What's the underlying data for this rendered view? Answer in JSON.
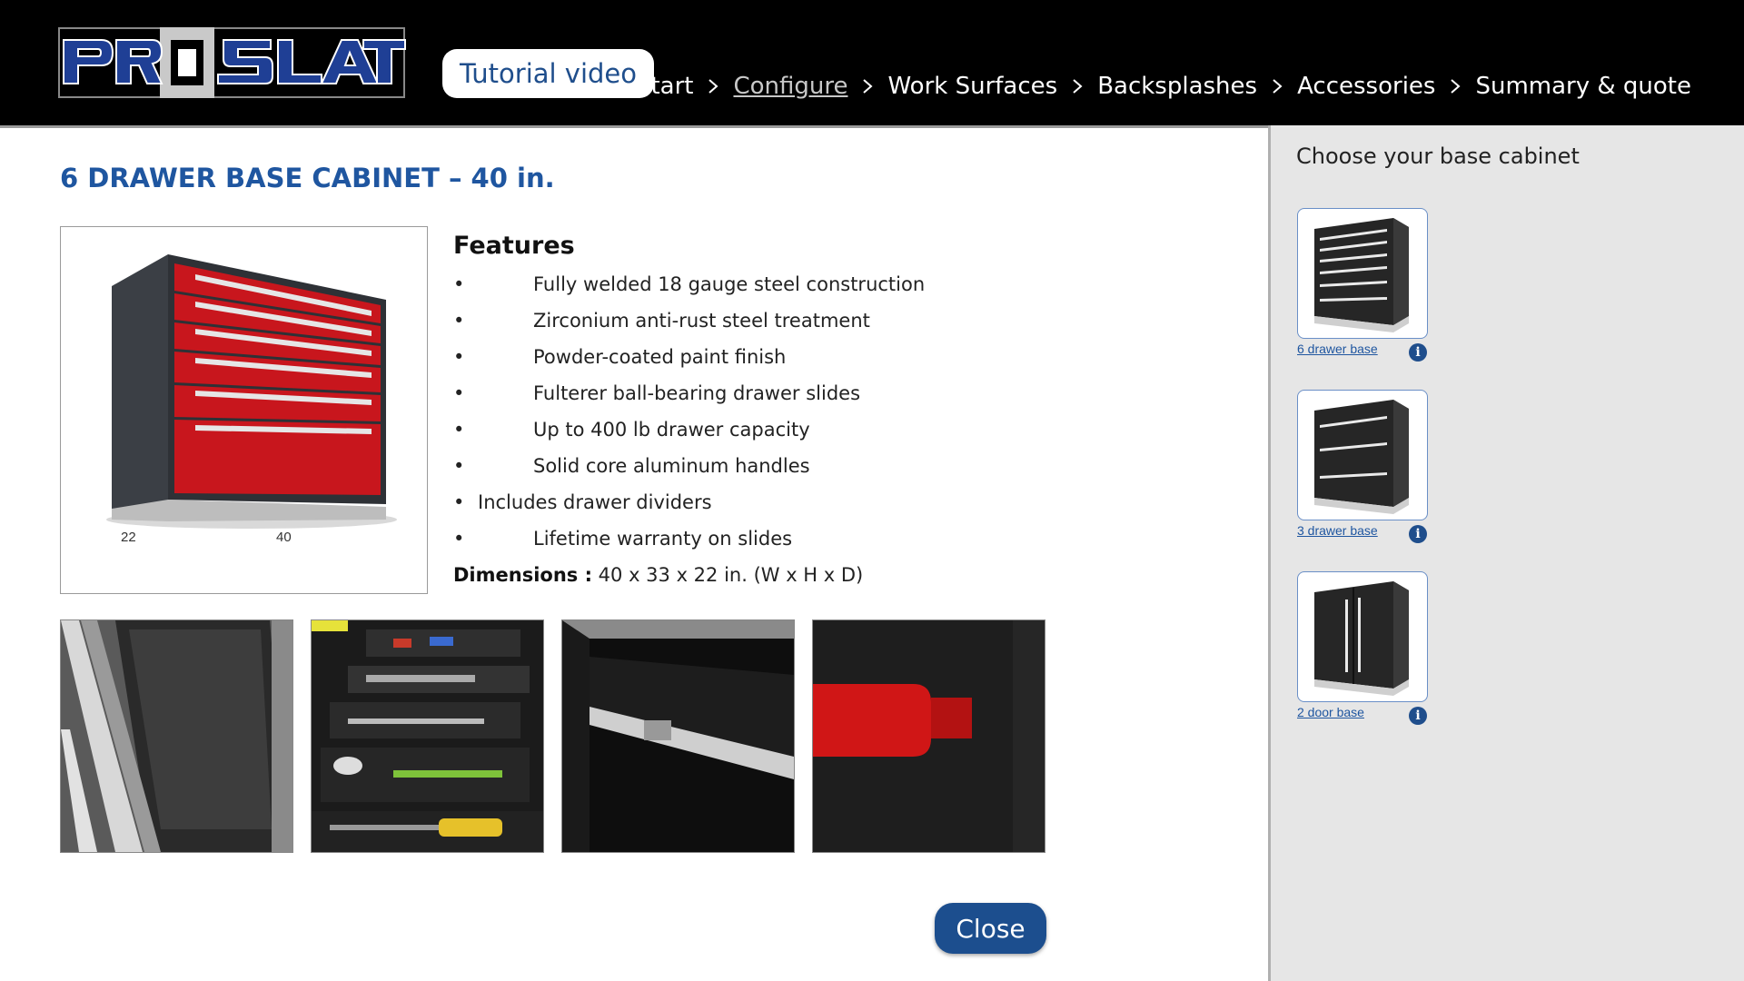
{
  "header": {
    "logo_text": "PROSLAT",
    "tutorial_label": "Tutorial video",
    "breadcrumb": [
      {
        "label": "Start"
      },
      {
        "label": "Configure",
        "current": true
      },
      {
        "label": "Work Surfaces"
      },
      {
        "label": "Backsplashes"
      },
      {
        "label": "Accessories"
      },
      {
        "label": "Summary & quote"
      }
    ]
  },
  "product": {
    "title": "6 DRAWER BASE CABINET – 40 in.",
    "image_dims": {
      "depth": "22",
      "width": "40"
    },
    "features_heading": "Features",
    "features": [
      "Fully welded 18 gauge steel construction",
      "Zirconium anti-rust steel treatment",
      "Powder-coated paint finish",
      "Fulterer ball-bearing drawer slides",
      "Up to 400 lb drawer capacity",
      "Solid core aluminum handles",
      "Includes drawer dividers",
      "Lifetime warranty on slides"
    ],
    "bullet": "•",
    "dimensions_label": "Dimensions :",
    "dimensions_value": " 40 x 33 x 22 in. (W x H x D)",
    "gallery": [
      {
        "icon": "drawer-liner-photo"
      },
      {
        "icon": "drawer-dividers-photo"
      },
      {
        "icon": "drawer-slide-photo"
      },
      {
        "icon": "red-handle-photo"
      }
    ],
    "close_label": "Close"
  },
  "sidebar": {
    "title": "Choose your base cabinet",
    "options": [
      {
        "label": "6 drawer base",
        "info": "i"
      },
      {
        "label": "3 drawer base",
        "info": "i"
      },
      {
        "label": "2 door base",
        "info": "i"
      }
    ]
  },
  "colors": {
    "accent_blue": "#1f56a0",
    "button_blue": "#1c4e8e",
    "cabinet_red": "#c8161d",
    "header_bg": "#000000",
    "sidebar_bg": "#e6e6e6"
  }
}
